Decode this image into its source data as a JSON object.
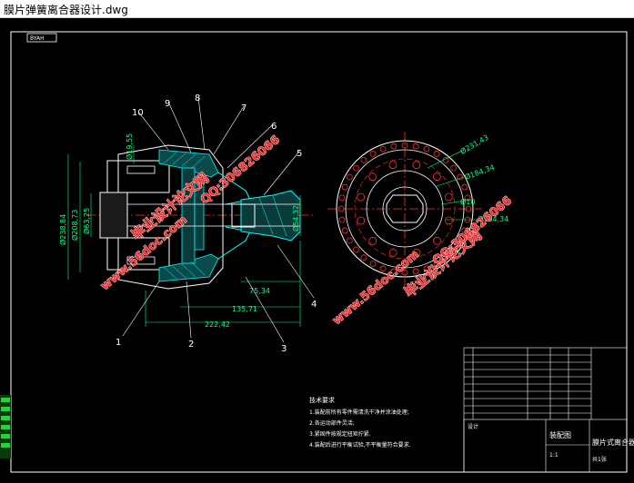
{
  "window": {
    "title": "膜片弹簧离合器设计.dwg"
  },
  "drawing": {
    "corner_tag": "BYAH",
    "dims": {
      "d_bore_top": "Ø19,55",
      "d_238": "Ø238,84",
      "d_208": "Ø208,73",
      "d_63": "Ø63,25",
      "d_54": "Ø54,32",
      "len_75": "75,34",
      "len_135": "135,71",
      "len_222": "222,42",
      "d_231": "Ø231,43",
      "d_184a": "Ø184,34",
      "d_10": "Ø10",
      "d_184b": "Ø184,34"
    },
    "callouts": [
      "1",
      "2",
      "3",
      "4",
      "5",
      "6",
      "7",
      "8",
      "9",
      "10"
    ],
    "notes": {
      "heading": "技术要求",
      "lines": [
        "1.装配前所有零件需清洗干净并涂油处理;",
        "2.各运动部件灵活;",
        "3.紧固件按规定扭矩拧紧.",
        "4.装配后进行平衡试验,不平衡量符合要求."
      ]
    },
    "title_block": {
      "part_name": "膜片式离合器",
      "scale": "1:1",
      "sheet": "共1张",
      "designer": "设计",
      "row_label": "装配图"
    },
    "watermarks": {
      "brand": "毕业设计论文网",
      "site": "www.56doc.com",
      "qq": "QQ:306826066"
    }
  },
  "colors": {
    "background": "#000000",
    "line": "#ffffff",
    "center": "#ff3030",
    "section": "#00ffff",
    "dim": "#00ff80",
    "watermark": "#ff2a2a"
  }
}
